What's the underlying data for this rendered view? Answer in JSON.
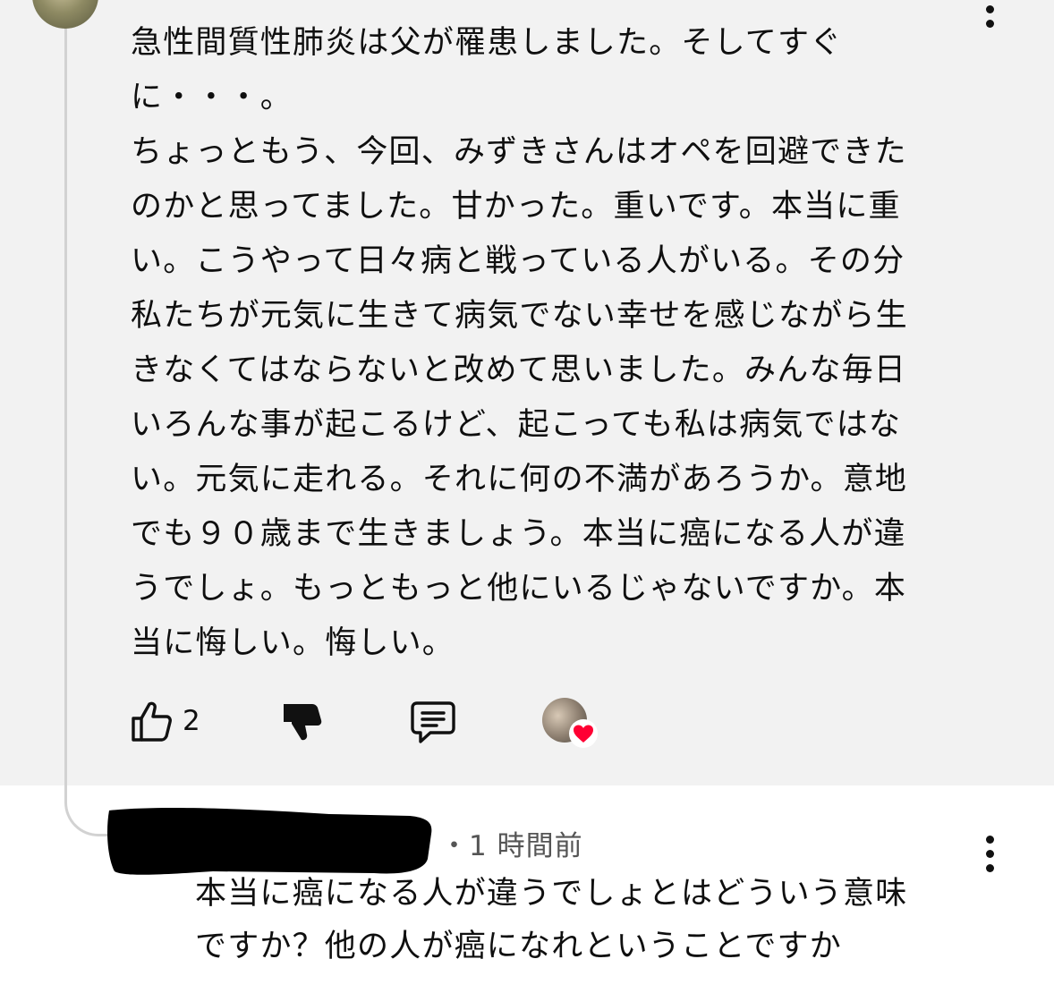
{
  "comment": {
    "text": "急性間質性肺炎は父が罹患しました。そしてすぐ\nに・・・。\nちょっともう、今回、みずきさんはオペを回避できた\nのかと思ってました。甘かった。重いです。本当に重\nい。こうやって日々病と戦っている人がいる。その分\n私たちが元気に生きて病気でない幸せを感じながら生\nきなくてはならないと改めて思いました。みんな毎日\nいろんな事が起こるけど、起こっても私は病気ではな\nい。元気に走れる。それに何の不満があろうか。意地\nでも９０歳まで生きましょう。本当に癌になる人が違\nうでしょ。もっともっと他にいるじゃないですか。本\n当に悔しい。悔しい。",
    "like_count": "2",
    "icons": {
      "like": "thumbs-up-icon",
      "dislike": "thumbs-down-icon",
      "reply": "comment-icon",
      "creator_heart": "heart-icon",
      "more": "more-vert-icon"
    }
  },
  "reply": {
    "time": "・1 時間前",
    "text": "本当に癌になる人が違うでしょとはどういう意味\nですか？他の人が癌になれということですか"
  },
  "colors": {
    "top_background": "#f2f2f2",
    "heart": "#ff0033",
    "meta_text": "#555555"
  }
}
